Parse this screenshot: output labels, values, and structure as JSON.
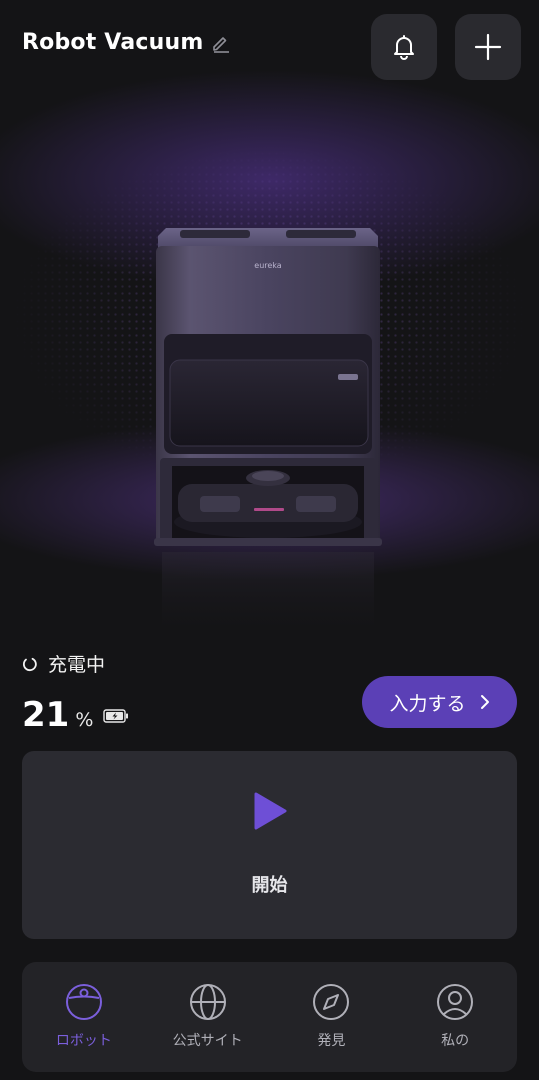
{
  "header": {
    "title": "Robot Vacuum",
    "edit_icon": "pencil-icon",
    "notification_icon": "bell-icon",
    "add_icon": "plus-icon"
  },
  "device": {
    "brand": "eureka"
  },
  "status": {
    "icon": "charging-spinner-icon",
    "text": "充電中"
  },
  "battery": {
    "level": "21",
    "unit": "%",
    "icon": "battery-charging-icon"
  },
  "actions": {
    "enter_label": "入力する",
    "start_label": "開始",
    "start_icon": "play-icon"
  },
  "tabs": [
    {
      "label": "ロボット",
      "icon": "robot-icon",
      "active": true
    },
    {
      "label": "公式サイト",
      "icon": "globe-icon",
      "active": false
    },
    {
      "label": "発見",
      "icon": "compass-icon",
      "active": false
    },
    {
      "label": "私の",
      "icon": "user-icon",
      "active": false
    }
  ],
  "colors": {
    "accent": "#5b40b6",
    "accent_light": "#7b5fdc",
    "background": "#141416",
    "card": "#2b2b31"
  }
}
